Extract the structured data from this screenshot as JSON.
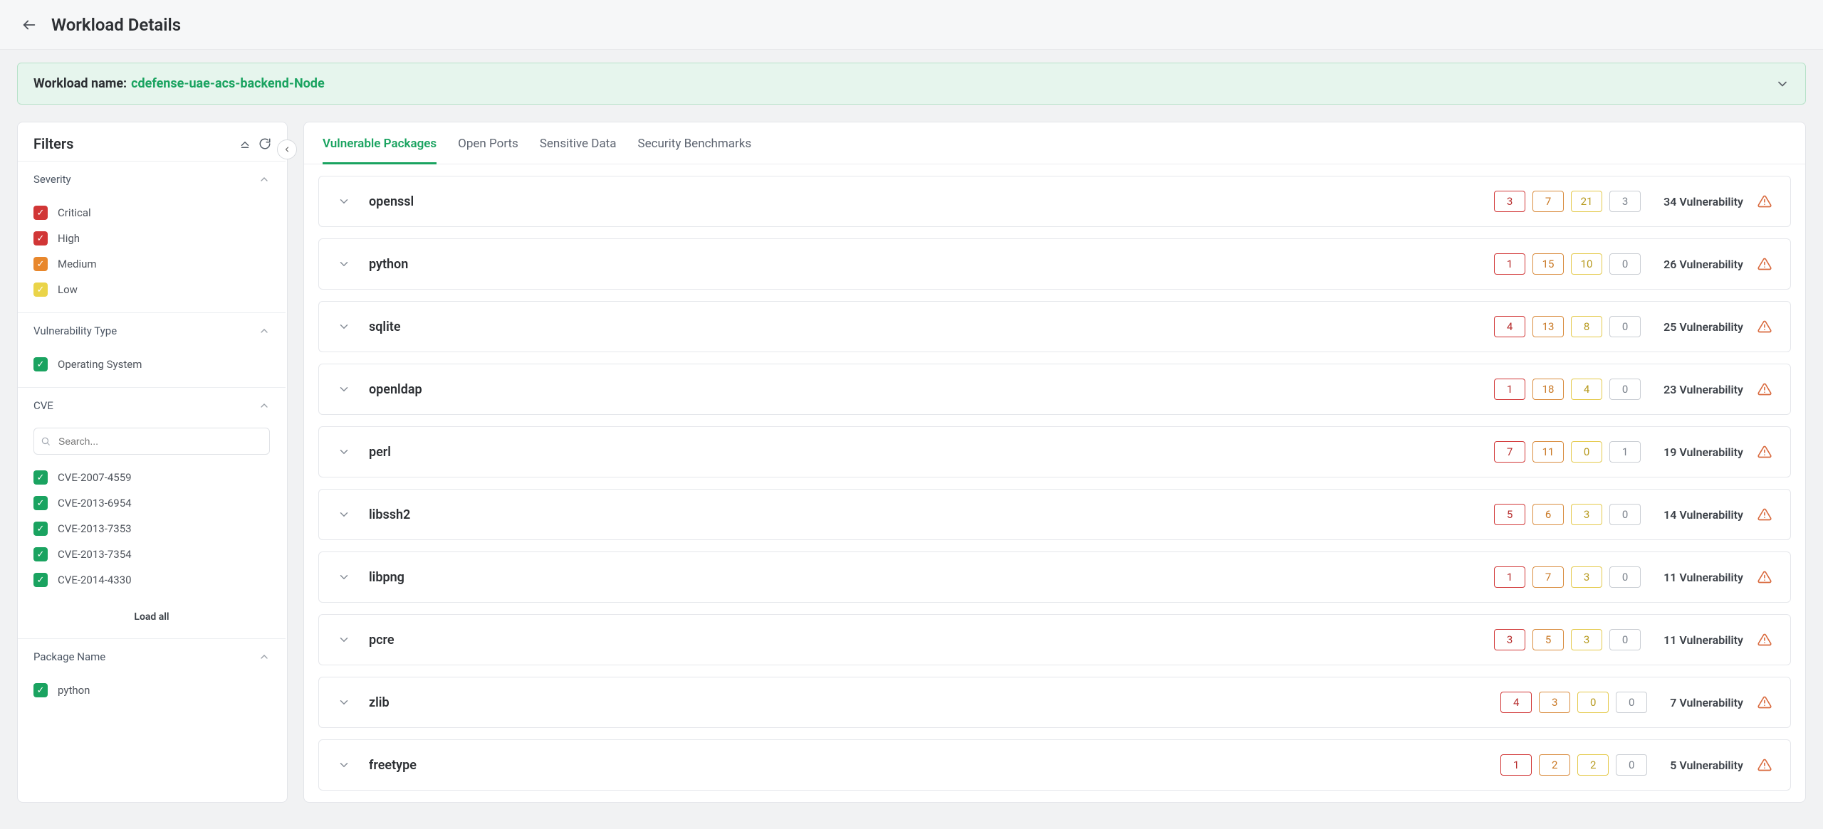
{
  "header": {
    "title": "Workload Details"
  },
  "banner": {
    "label": "Workload name:",
    "value": "cdefense-uae-acs-backend-Node"
  },
  "filters": {
    "title": "Filters",
    "sections": {
      "severity": {
        "title": "Severity",
        "items": [
          {
            "label": "Critical",
            "color": "red"
          },
          {
            "label": "High",
            "color": "red"
          },
          {
            "label": "Medium",
            "color": "orange"
          },
          {
            "label": "Low",
            "color": "yellow"
          }
        ]
      },
      "vuln_type": {
        "title": "Vulnerability Type",
        "items": [
          {
            "label": "Operating System",
            "color": "green"
          }
        ]
      },
      "cve": {
        "title": "CVE",
        "search_placeholder": "Search...",
        "items": [
          {
            "label": "CVE-2007-4559",
            "color": "green"
          },
          {
            "label": "CVE-2013-6954",
            "color": "green"
          },
          {
            "label": "CVE-2013-7353",
            "color": "green"
          },
          {
            "label": "CVE-2013-7354",
            "color": "green"
          },
          {
            "label": "CVE-2014-4330",
            "color": "green"
          }
        ],
        "load_all": "Load all"
      },
      "package_name": {
        "title": "Package Name",
        "items": [
          {
            "label": "python",
            "color": "green"
          }
        ]
      }
    }
  },
  "tabs": [
    {
      "label": "Vulnerable Packages",
      "active": true
    },
    {
      "label": "Open Ports",
      "active": false
    },
    {
      "label": "Sensitive Data",
      "active": false
    },
    {
      "label": "Security Benchmarks",
      "active": false
    }
  ],
  "vuln_suffix": "Vulnerability",
  "packages": [
    {
      "name": "openssl",
      "sev": [
        3,
        7,
        21,
        3
      ],
      "total": 34
    },
    {
      "name": "python",
      "sev": [
        1,
        15,
        10,
        0
      ],
      "total": 26
    },
    {
      "name": "sqlite",
      "sev": [
        4,
        13,
        8,
        0
      ],
      "total": 25
    },
    {
      "name": "openldap",
      "sev": [
        1,
        18,
        4,
        0
      ],
      "total": 23
    },
    {
      "name": "perl",
      "sev": [
        7,
        11,
        0,
        1
      ],
      "total": 19
    },
    {
      "name": "libssh2",
      "sev": [
        5,
        6,
        3,
        0
      ],
      "total": 14
    },
    {
      "name": "libpng",
      "sev": [
        1,
        7,
        3,
        0
      ],
      "total": 11
    },
    {
      "name": "pcre",
      "sev": [
        3,
        5,
        3,
        0
      ],
      "total": 11
    },
    {
      "name": "zlib",
      "sev": [
        4,
        3,
        0,
        0
      ],
      "total": 7
    },
    {
      "name": "freetype",
      "sev": [
        1,
        2,
        2,
        0
      ],
      "total": 5
    }
  ]
}
